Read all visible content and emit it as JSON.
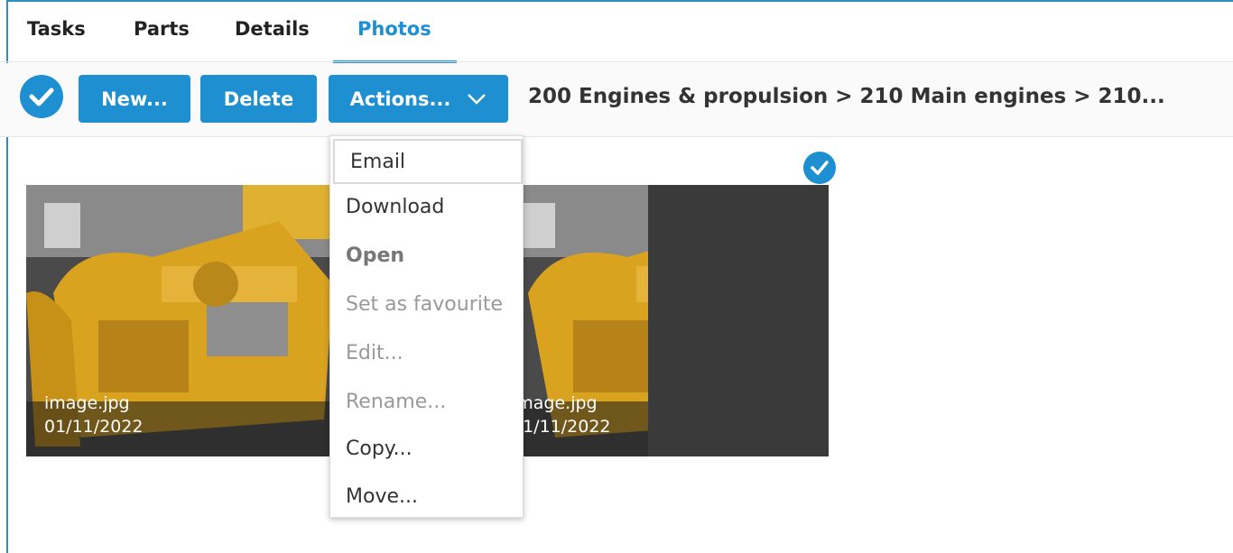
{
  "tabs": [
    {
      "label": "Tasks"
    },
    {
      "label": "Parts"
    },
    {
      "label": "Details"
    },
    {
      "label": "Photos",
      "active": true
    }
  ],
  "toolbar": {
    "new_label": "New...",
    "delete_label": "Delete",
    "actions_label": "Actions...",
    "breadcrumb": "200 Engines & propulsion > 210 Main engines > 210..."
  },
  "photos": [
    {
      "name": "image.jpg",
      "date": "01/11/2022"
    },
    {
      "name": "image.jpg",
      "date": "01/11/2022",
      "selected": true
    }
  ],
  "actions_menu": {
    "items": [
      {
        "label": "Email",
        "state": "enabled",
        "focused": true
      },
      {
        "label": "Download",
        "state": "enabled"
      },
      {
        "label": "Open",
        "state": "bold"
      },
      {
        "label": "Set as favourite",
        "state": "disabled"
      },
      {
        "label": "Edit...",
        "state": "disabled"
      },
      {
        "label": "Rename...",
        "state": "disabled"
      },
      {
        "label": "Copy...",
        "state": "enabled"
      },
      {
        "label": "Move...",
        "state": "enabled"
      }
    ]
  },
  "colors": {
    "accent": "#1e8fd0"
  },
  "icons": {
    "select_all": "check-circle-icon",
    "dropdown": "chevron-down-icon",
    "selected": "check-circle-icon"
  }
}
